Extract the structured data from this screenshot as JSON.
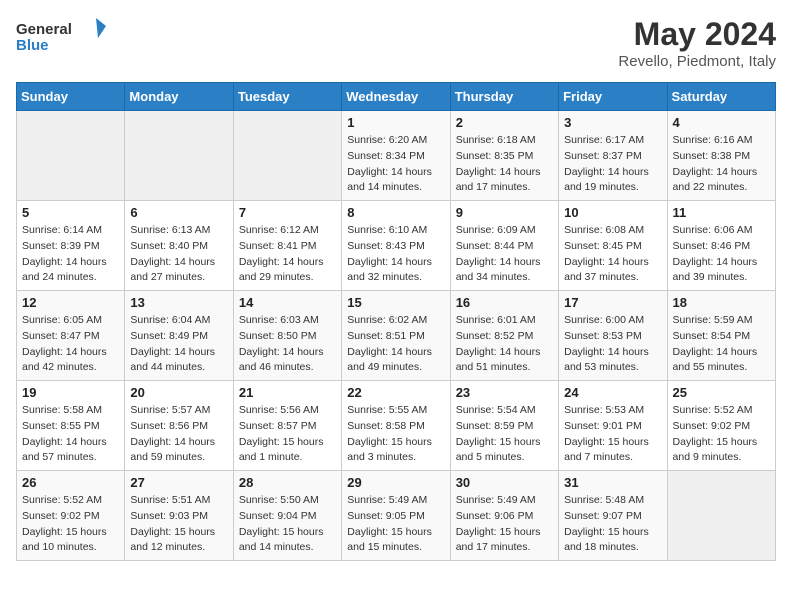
{
  "header": {
    "logo_general": "General",
    "logo_blue": "Blue",
    "title": "May 2024",
    "subtitle": "Revello, Piedmont, Italy"
  },
  "days_of_week": [
    "Sunday",
    "Monday",
    "Tuesday",
    "Wednesday",
    "Thursday",
    "Friday",
    "Saturday"
  ],
  "weeks": [
    [
      {
        "day": "",
        "sunrise": "",
        "sunset": "",
        "daylight": ""
      },
      {
        "day": "",
        "sunrise": "",
        "sunset": "",
        "daylight": ""
      },
      {
        "day": "",
        "sunrise": "",
        "sunset": "",
        "daylight": ""
      },
      {
        "day": "1",
        "sunrise": "Sunrise: 6:20 AM",
        "sunset": "Sunset: 8:34 PM",
        "daylight": "Daylight: 14 hours and 14 minutes."
      },
      {
        "day": "2",
        "sunrise": "Sunrise: 6:18 AM",
        "sunset": "Sunset: 8:35 PM",
        "daylight": "Daylight: 14 hours and 17 minutes."
      },
      {
        "day": "3",
        "sunrise": "Sunrise: 6:17 AM",
        "sunset": "Sunset: 8:37 PM",
        "daylight": "Daylight: 14 hours and 19 minutes."
      },
      {
        "day": "4",
        "sunrise": "Sunrise: 6:16 AM",
        "sunset": "Sunset: 8:38 PM",
        "daylight": "Daylight: 14 hours and 22 minutes."
      }
    ],
    [
      {
        "day": "5",
        "sunrise": "Sunrise: 6:14 AM",
        "sunset": "Sunset: 8:39 PM",
        "daylight": "Daylight: 14 hours and 24 minutes."
      },
      {
        "day": "6",
        "sunrise": "Sunrise: 6:13 AM",
        "sunset": "Sunset: 8:40 PM",
        "daylight": "Daylight: 14 hours and 27 minutes."
      },
      {
        "day": "7",
        "sunrise": "Sunrise: 6:12 AM",
        "sunset": "Sunset: 8:41 PM",
        "daylight": "Daylight: 14 hours and 29 minutes."
      },
      {
        "day": "8",
        "sunrise": "Sunrise: 6:10 AM",
        "sunset": "Sunset: 8:43 PM",
        "daylight": "Daylight: 14 hours and 32 minutes."
      },
      {
        "day": "9",
        "sunrise": "Sunrise: 6:09 AM",
        "sunset": "Sunset: 8:44 PM",
        "daylight": "Daylight: 14 hours and 34 minutes."
      },
      {
        "day": "10",
        "sunrise": "Sunrise: 6:08 AM",
        "sunset": "Sunset: 8:45 PM",
        "daylight": "Daylight: 14 hours and 37 minutes."
      },
      {
        "day": "11",
        "sunrise": "Sunrise: 6:06 AM",
        "sunset": "Sunset: 8:46 PM",
        "daylight": "Daylight: 14 hours and 39 minutes."
      }
    ],
    [
      {
        "day": "12",
        "sunrise": "Sunrise: 6:05 AM",
        "sunset": "Sunset: 8:47 PM",
        "daylight": "Daylight: 14 hours and 42 minutes."
      },
      {
        "day": "13",
        "sunrise": "Sunrise: 6:04 AM",
        "sunset": "Sunset: 8:49 PM",
        "daylight": "Daylight: 14 hours and 44 minutes."
      },
      {
        "day": "14",
        "sunrise": "Sunrise: 6:03 AM",
        "sunset": "Sunset: 8:50 PM",
        "daylight": "Daylight: 14 hours and 46 minutes."
      },
      {
        "day": "15",
        "sunrise": "Sunrise: 6:02 AM",
        "sunset": "Sunset: 8:51 PM",
        "daylight": "Daylight: 14 hours and 49 minutes."
      },
      {
        "day": "16",
        "sunrise": "Sunrise: 6:01 AM",
        "sunset": "Sunset: 8:52 PM",
        "daylight": "Daylight: 14 hours and 51 minutes."
      },
      {
        "day": "17",
        "sunrise": "Sunrise: 6:00 AM",
        "sunset": "Sunset: 8:53 PM",
        "daylight": "Daylight: 14 hours and 53 minutes."
      },
      {
        "day": "18",
        "sunrise": "Sunrise: 5:59 AM",
        "sunset": "Sunset: 8:54 PM",
        "daylight": "Daylight: 14 hours and 55 minutes."
      }
    ],
    [
      {
        "day": "19",
        "sunrise": "Sunrise: 5:58 AM",
        "sunset": "Sunset: 8:55 PM",
        "daylight": "Daylight: 14 hours and 57 minutes."
      },
      {
        "day": "20",
        "sunrise": "Sunrise: 5:57 AM",
        "sunset": "Sunset: 8:56 PM",
        "daylight": "Daylight: 14 hours and 59 minutes."
      },
      {
        "day": "21",
        "sunrise": "Sunrise: 5:56 AM",
        "sunset": "Sunset: 8:57 PM",
        "daylight": "Daylight: 15 hours and 1 minute."
      },
      {
        "day": "22",
        "sunrise": "Sunrise: 5:55 AM",
        "sunset": "Sunset: 8:58 PM",
        "daylight": "Daylight: 15 hours and 3 minutes."
      },
      {
        "day": "23",
        "sunrise": "Sunrise: 5:54 AM",
        "sunset": "Sunset: 8:59 PM",
        "daylight": "Daylight: 15 hours and 5 minutes."
      },
      {
        "day": "24",
        "sunrise": "Sunrise: 5:53 AM",
        "sunset": "Sunset: 9:01 PM",
        "daylight": "Daylight: 15 hours and 7 minutes."
      },
      {
        "day": "25",
        "sunrise": "Sunrise: 5:52 AM",
        "sunset": "Sunset: 9:02 PM",
        "daylight": "Daylight: 15 hours and 9 minutes."
      }
    ],
    [
      {
        "day": "26",
        "sunrise": "Sunrise: 5:52 AM",
        "sunset": "Sunset: 9:02 PM",
        "daylight": "Daylight: 15 hours and 10 minutes."
      },
      {
        "day": "27",
        "sunrise": "Sunrise: 5:51 AM",
        "sunset": "Sunset: 9:03 PM",
        "daylight": "Daylight: 15 hours and 12 minutes."
      },
      {
        "day": "28",
        "sunrise": "Sunrise: 5:50 AM",
        "sunset": "Sunset: 9:04 PM",
        "daylight": "Daylight: 15 hours and 14 minutes."
      },
      {
        "day": "29",
        "sunrise": "Sunrise: 5:49 AM",
        "sunset": "Sunset: 9:05 PM",
        "daylight": "Daylight: 15 hours and 15 minutes."
      },
      {
        "day": "30",
        "sunrise": "Sunrise: 5:49 AM",
        "sunset": "Sunset: 9:06 PM",
        "daylight": "Daylight: 15 hours and 17 minutes."
      },
      {
        "day": "31",
        "sunrise": "Sunrise: 5:48 AM",
        "sunset": "Sunset: 9:07 PM",
        "daylight": "Daylight: 15 hours and 18 minutes."
      },
      {
        "day": "",
        "sunrise": "",
        "sunset": "",
        "daylight": ""
      }
    ]
  ]
}
